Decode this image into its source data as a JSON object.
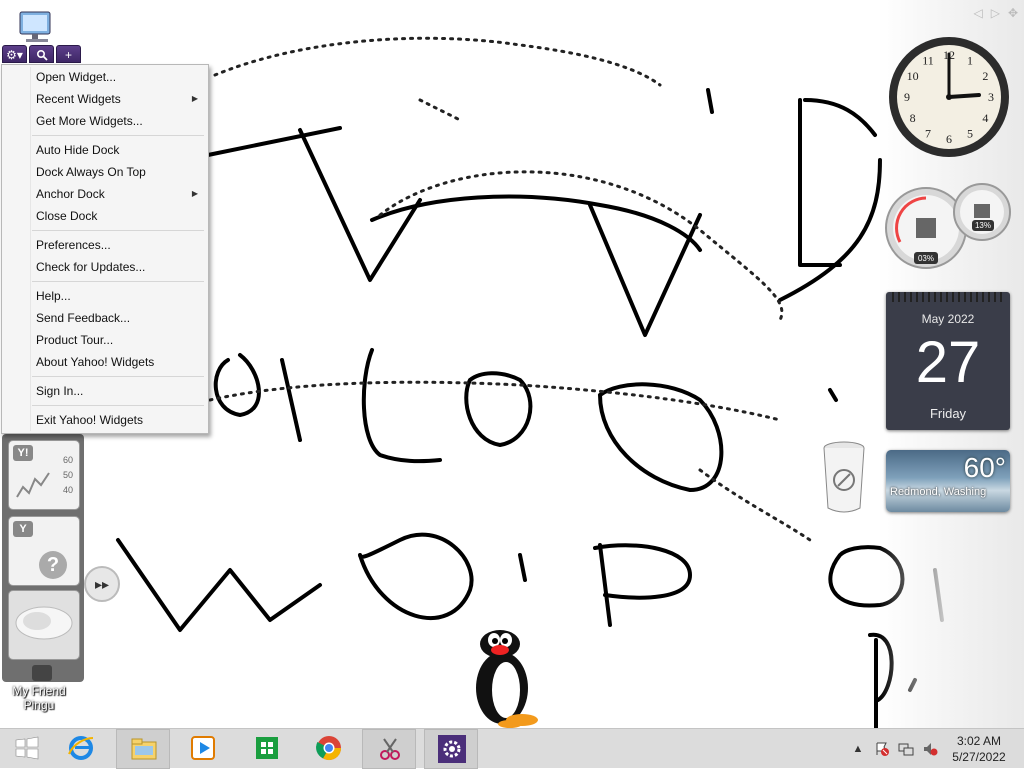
{
  "desktop": {
    "icon_label": "My Friend\nPingu"
  },
  "dock": {
    "buttons": [
      {
        "name": "gear-dropdown",
        "glyph": "⚙▾"
      },
      {
        "name": "search",
        "glyph": "🔍"
      },
      {
        "name": "add",
        "glyph": "+"
      }
    ],
    "stock_widget": {
      "badge": "Y!",
      "values": [
        "60",
        "50",
        "40"
      ]
    },
    "help_widget": {
      "badge": "Y",
      "glyph": "?"
    },
    "forward_button": "▸▸"
  },
  "menu": {
    "items": [
      {
        "label": "Open Widget...",
        "submenu": false
      },
      {
        "label": "Recent Widgets",
        "submenu": true
      },
      {
        "label": "Get More Widgets...",
        "submenu": false
      },
      {
        "label": "Auto Hide Dock",
        "submenu": false
      },
      {
        "label": "Dock Always On Top",
        "submenu": false
      },
      {
        "label": "Anchor Dock",
        "submenu": true
      },
      {
        "label": "Close Dock",
        "submenu": false
      },
      {
        "label": "Preferences...",
        "submenu": false
      },
      {
        "label": "Check for Updates...",
        "submenu": false
      },
      {
        "label": "Help...",
        "submenu": false
      },
      {
        "label": "Send Feedback...",
        "submenu": false
      },
      {
        "label": "Product Tour...",
        "submenu": false
      },
      {
        "label": "About Yahoo! Widgets",
        "submenu": false
      },
      {
        "label": "Sign In...",
        "submenu": false
      },
      {
        "label": "Exit Yahoo! Widgets",
        "submenu": false
      }
    ],
    "submenu_arrow": "▶"
  },
  "gadgets": {
    "controls": [
      "◁",
      "▷",
      "✥"
    ],
    "clock_numbers": [
      "12",
      "1",
      "2",
      "3",
      "4",
      "5",
      "6",
      "7",
      "8",
      "9",
      "10",
      "11"
    ],
    "cpu": {
      "cpu_label": "03%",
      "mem_label": "13%"
    },
    "calendar": {
      "month": "May 2022",
      "day": "27",
      "weekday": "Friday"
    },
    "weather": {
      "temp": "60°",
      "location": "Redmond, Washing"
    }
  },
  "taskbar": {
    "apps": [
      {
        "name": "start",
        "icon": "windows-logo"
      },
      {
        "name": "internet-explorer",
        "icon": "ie"
      },
      {
        "name": "file-explorer",
        "icon": "folder"
      },
      {
        "name": "media-player",
        "icon": "video"
      },
      {
        "name": "store",
        "icon": "store"
      },
      {
        "name": "chrome",
        "icon": "chrome"
      },
      {
        "name": "snipping-tool",
        "icon": "scissors"
      },
      {
        "name": "yahoo-widgets",
        "icon": "gear"
      }
    ],
    "tray": {
      "show_hidden": "▲",
      "time": "3:02 AM",
      "date": "5/27/2022"
    }
  },
  "colors": {
    "dock_purple": "#4b2f7a",
    "taskbar": "#dcdcdc",
    "calendar_bg": "#3a3d49"
  }
}
